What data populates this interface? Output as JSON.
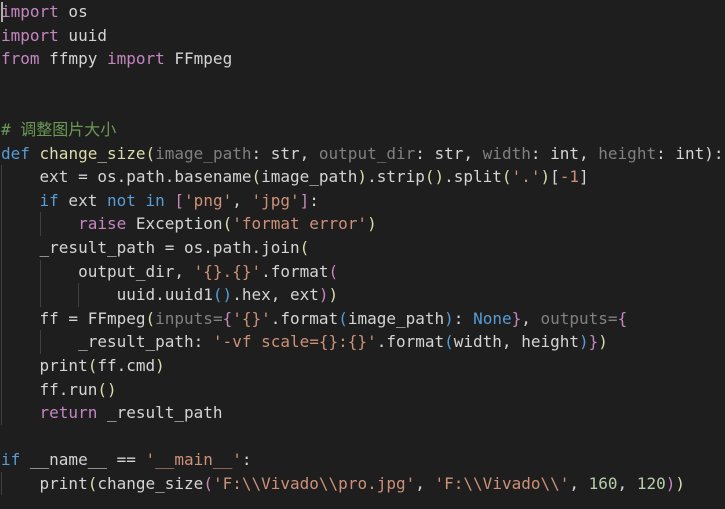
{
  "editor": {
    "colors": {
      "background": "#1e1e1e",
      "keyword": "#569cd6",
      "control": "#c586c0",
      "function": "#dcdcaa",
      "string": "#ce9178",
      "number": "#b5cea8",
      "comment": "#6a9955",
      "parameter": "#808080",
      "text": "#d4d4d4"
    },
    "lines": [
      {
        "indent": 0,
        "tokens": [
          {
            "t": "import",
            "c": "ctl"
          },
          {
            "t": " os",
            "c": "plain"
          }
        ]
      },
      {
        "indent": 0,
        "tokens": [
          {
            "t": "import",
            "c": "ctl"
          },
          {
            "t": " uuid",
            "c": "plain"
          }
        ]
      },
      {
        "indent": 0,
        "tokens": [
          {
            "t": "from",
            "c": "ctl"
          },
          {
            "t": " ffmpy ",
            "c": "plain"
          },
          {
            "t": "import",
            "c": "ctl"
          },
          {
            "t": " FFmpeg",
            "c": "plain"
          }
        ]
      },
      {
        "indent": 0,
        "tokens": []
      },
      {
        "indent": 0,
        "tokens": []
      },
      {
        "indent": 0,
        "tokens": [
          {
            "t": "# 调整图片大小",
            "c": "cmt"
          }
        ]
      },
      {
        "indent": 0,
        "tokens": [
          {
            "t": "def",
            "c": "kw"
          },
          {
            "t": " change_size",
            "c": "fn"
          },
          {
            "t": "(",
            "c": "fn"
          },
          {
            "t": "image_path",
            "c": "param"
          },
          {
            "t": ": str, ",
            "c": "plain"
          },
          {
            "t": "output_dir",
            "c": "param"
          },
          {
            "t": ": str, ",
            "c": "plain"
          },
          {
            "t": "width",
            "c": "param"
          },
          {
            "t": ": int, ",
            "c": "plain"
          },
          {
            "t": "height",
            "c": "param"
          },
          {
            "t": ": int):",
            "c": "plain"
          }
        ]
      },
      {
        "indent": 1,
        "tokens": [
          {
            "t": "ext = os.path.basename",
            "c": "plain"
          },
          {
            "t": "(",
            "c": "fn"
          },
          {
            "t": "image_path",
            "c": "plain"
          },
          {
            "t": ")",
            "c": "fn"
          },
          {
            "t": ".strip",
            "c": "plain"
          },
          {
            "t": "()",
            "c": "fn"
          },
          {
            "t": ".split",
            "c": "plain"
          },
          {
            "t": "(",
            "c": "fn"
          },
          {
            "t": "'.'",
            "c": "str"
          },
          {
            "t": ")",
            "c": "fn"
          },
          {
            "t": "[",
            "c": "plain"
          },
          {
            "t": "-1",
            "c": "str"
          },
          {
            "t": "]",
            "c": "plain"
          }
        ]
      },
      {
        "indent": 1,
        "tokens": [
          {
            "t": "if",
            "c": "kw"
          },
          {
            "t": " ext ",
            "c": "plain"
          },
          {
            "t": "not in",
            "c": "kw"
          },
          {
            "t": " ",
            "c": "plain"
          },
          {
            "t": "[",
            "c": "ctl"
          },
          {
            "t": "'png'",
            "c": "str"
          },
          {
            "t": ", ",
            "c": "plain"
          },
          {
            "t": "'jpg'",
            "c": "str"
          },
          {
            "t": "]",
            "c": "ctl"
          },
          {
            "t": ":",
            "c": "plain"
          }
        ]
      },
      {
        "indent": 2,
        "tokens": [
          {
            "t": "raise",
            "c": "ctl"
          },
          {
            "t": " Exception",
            "c": "plain"
          },
          {
            "t": "(",
            "c": "fn"
          },
          {
            "t": "'format error'",
            "c": "str"
          },
          {
            "t": ")",
            "c": "fn"
          }
        ]
      },
      {
        "indent": 1,
        "tokens": [
          {
            "t": "_result_path = os.path.join",
            "c": "plain"
          },
          {
            "t": "(",
            "c": "fn"
          }
        ]
      },
      {
        "indent": 2,
        "tokens": [
          {
            "t": "output_dir, ",
            "c": "plain"
          },
          {
            "t": "'{}.{}'",
            "c": "str"
          },
          {
            "t": ".format",
            "c": "plain"
          },
          {
            "t": "(",
            "c": "ctl"
          }
        ]
      },
      {
        "indent": 3,
        "tokens": [
          {
            "t": "uuid.uuid1",
            "c": "plain"
          },
          {
            "t": "()",
            "c": "kw"
          },
          {
            "t": ".hex, ext",
            "c": "plain"
          },
          {
            "t": ")",
            "c": "ctl"
          },
          {
            "t": ")",
            "c": "fn"
          }
        ]
      },
      {
        "indent": 1,
        "tokens": [
          {
            "t": "ff = FFmpeg",
            "c": "plain"
          },
          {
            "t": "(",
            "c": "fn"
          },
          {
            "t": "inputs=",
            "c": "param"
          },
          {
            "t": "{",
            "c": "ctl"
          },
          {
            "t": "'{}'",
            "c": "str"
          },
          {
            "t": ".format",
            "c": "plain"
          },
          {
            "t": "(",
            "c": "kw"
          },
          {
            "t": "image_path",
            "c": "plain"
          },
          {
            "t": ")",
            "c": "kw"
          },
          {
            "t": ": ",
            "c": "plain"
          },
          {
            "t": "None",
            "c": "kw"
          },
          {
            "t": "}",
            "c": "ctl"
          },
          {
            "t": ", ",
            "c": "plain"
          },
          {
            "t": "outputs=",
            "c": "param"
          },
          {
            "t": "{",
            "c": "ctl"
          }
        ]
      },
      {
        "indent": 2,
        "tokens": [
          {
            "t": "_result_path: ",
            "c": "plain"
          },
          {
            "t": "'-vf scale={}:{}'",
            "c": "str"
          },
          {
            "t": ".format",
            "c": "plain"
          },
          {
            "t": "(",
            "c": "kw"
          },
          {
            "t": "width, height",
            "c": "plain"
          },
          {
            "t": ")",
            "c": "kw"
          },
          {
            "t": "}",
            "c": "ctl"
          },
          {
            "t": ")",
            "c": "fn"
          }
        ]
      },
      {
        "indent": 1,
        "tokens": [
          {
            "t": "print",
            "c": "plain"
          },
          {
            "t": "(",
            "c": "fn"
          },
          {
            "t": "ff.cmd",
            "c": "plain"
          },
          {
            "t": ")",
            "c": "fn"
          }
        ]
      },
      {
        "indent": 1,
        "tokens": [
          {
            "t": "ff.run",
            "c": "plain"
          },
          {
            "t": "()",
            "c": "fn"
          }
        ]
      },
      {
        "indent": 1,
        "tokens": [
          {
            "t": "return",
            "c": "ctl"
          },
          {
            "t": " _result_path",
            "c": "plain"
          }
        ]
      },
      {
        "indent": 0,
        "tokens": []
      },
      {
        "indent": 0,
        "tokens": [
          {
            "t": "if",
            "c": "kw"
          },
          {
            "t": " __name__ == ",
            "c": "plain"
          },
          {
            "t": "'__main__'",
            "c": "str"
          },
          {
            "t": ":",
            "c": "plain"
          }
        ]
      },
      {
        "indent": 1,
        "tokens": [
          {
            "t": "print",
            "c": "plain"
          },
          {
            "t": "(",
            "c": "fn"
          },
          {
            "t": "change_size",
            "c": "plain"
          },
          {
            "t": "(",
            "c": "ctl"
          },
          {
            "t": "'F:\\\\Vivado\\\\pro.jpg'",
            "c": "str"
          },
          {
            "t": ", ",
            "c": "plain"
          },
          {
            "t": "'F:\\\\Vivado\\\\'",
            "c": "str"
          },
          {
            "t": ", ",
            "c": "plain"
          },
          {
            "t": "160",
            "c": "num"
          },
          {
            "t": ", ",
            "c": "plain"
          },
          {
            "t": "120",
            "c": "num"
          },
          {
            "t": ")",
            "c": "ctl"
          },
          {
            "t": ")",
            "c": "fn"
          }
        ]
      }
    ]
  }
}
